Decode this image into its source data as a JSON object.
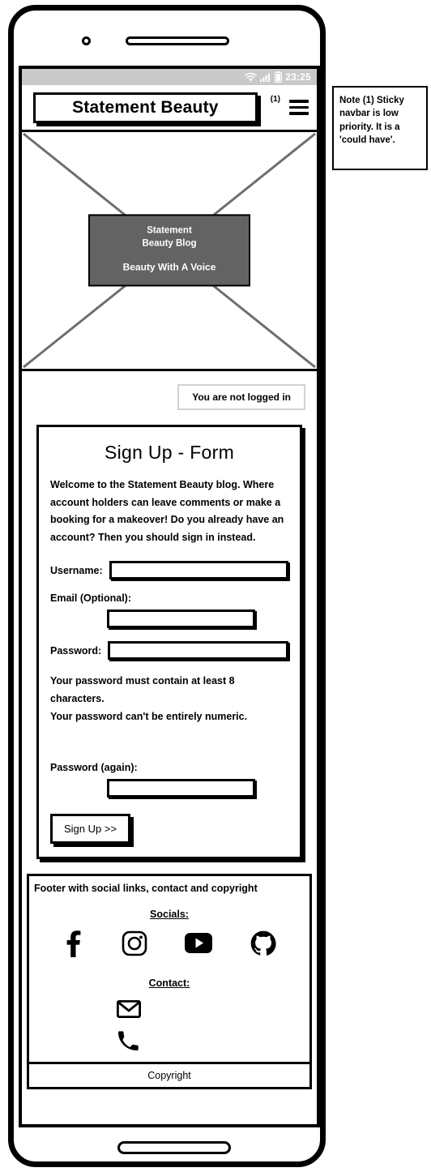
{
  "statusbar": {
    "time": "23:25",
    "icons": [
      "wifi-icon",
      "cellular-signal-icon",
      "battery-icon"
    ]
  },
  "navbar": {
    "brand": "Statement Beauty",
    "note_ref": "(1)",
    "menu_icon": "hamburger-menu-icon"
  },
  "note": {
    "text": "Note (1) Sticky navbar is low priority. It is a 'could have'."
  },
  "hero": {
    "placeholder": "image-placeholder",
    "title_line1": "Statement",
    "title_line2": "Beauty Blog",
    "tagline": "Beauty With A Voice"
  },
  "login_status": {
    "text": "You are not logged in"
  },
  "form": {
    "title": "Sign Up - Form",
    "description": "Welcome to the Statement Beauty blog. Where account holders can leave comments or make a booking for a makeover! Do you already have an account? Then you should sign in instead.",
    "fields": [
      {
        "label": "Username:",
        "value": "",
        "placeholder": "",
        "layout": "inline"
      },
      {
        "label": "Email (Optional):",
        "value": "",
        "placeholder": "",
        "layout": "stacked"
      },
      {
        "label": "Password:",
        "value": "",
        "placeholder": "",
        "layout": "inline"
      },
      {
        "label": "Password (again):",
        "value": "",
        "placeholder": "",
        "layout": "stacked"
      }
    ],
    "help_line1": "Your password must contain at least 8 characters.",
    "help_line2": "Your password can't be entirely numeric.",
    "submit_label": "Sign Up >>"
  },
  "footer": {
    "note": "Footer with social links, contact and copyright",
    "socials_heading": "Socials:",
    "socials": [
      {
        "name": "facebook-icon"
      },
      {
        "name": "instagram-icon"
      },
      {
        "name": "youtube-icon"
      },
      {
        "name": "github-icon"
      }
    ],
    "contact_heading": "Contact:",
    "contacts": [
      {
        "name": "email-icon"
      },
      {
        "name": "phone-icon"
      }
    ],
    "copyright": "Copyright"
  },
  "colors": {
    "outline": "#000000",
    "status_bar": "#c9c9c9",
    "hero_overlay": "#636363",
    "placeholder_line": "#6e6e6e"
  }
}
